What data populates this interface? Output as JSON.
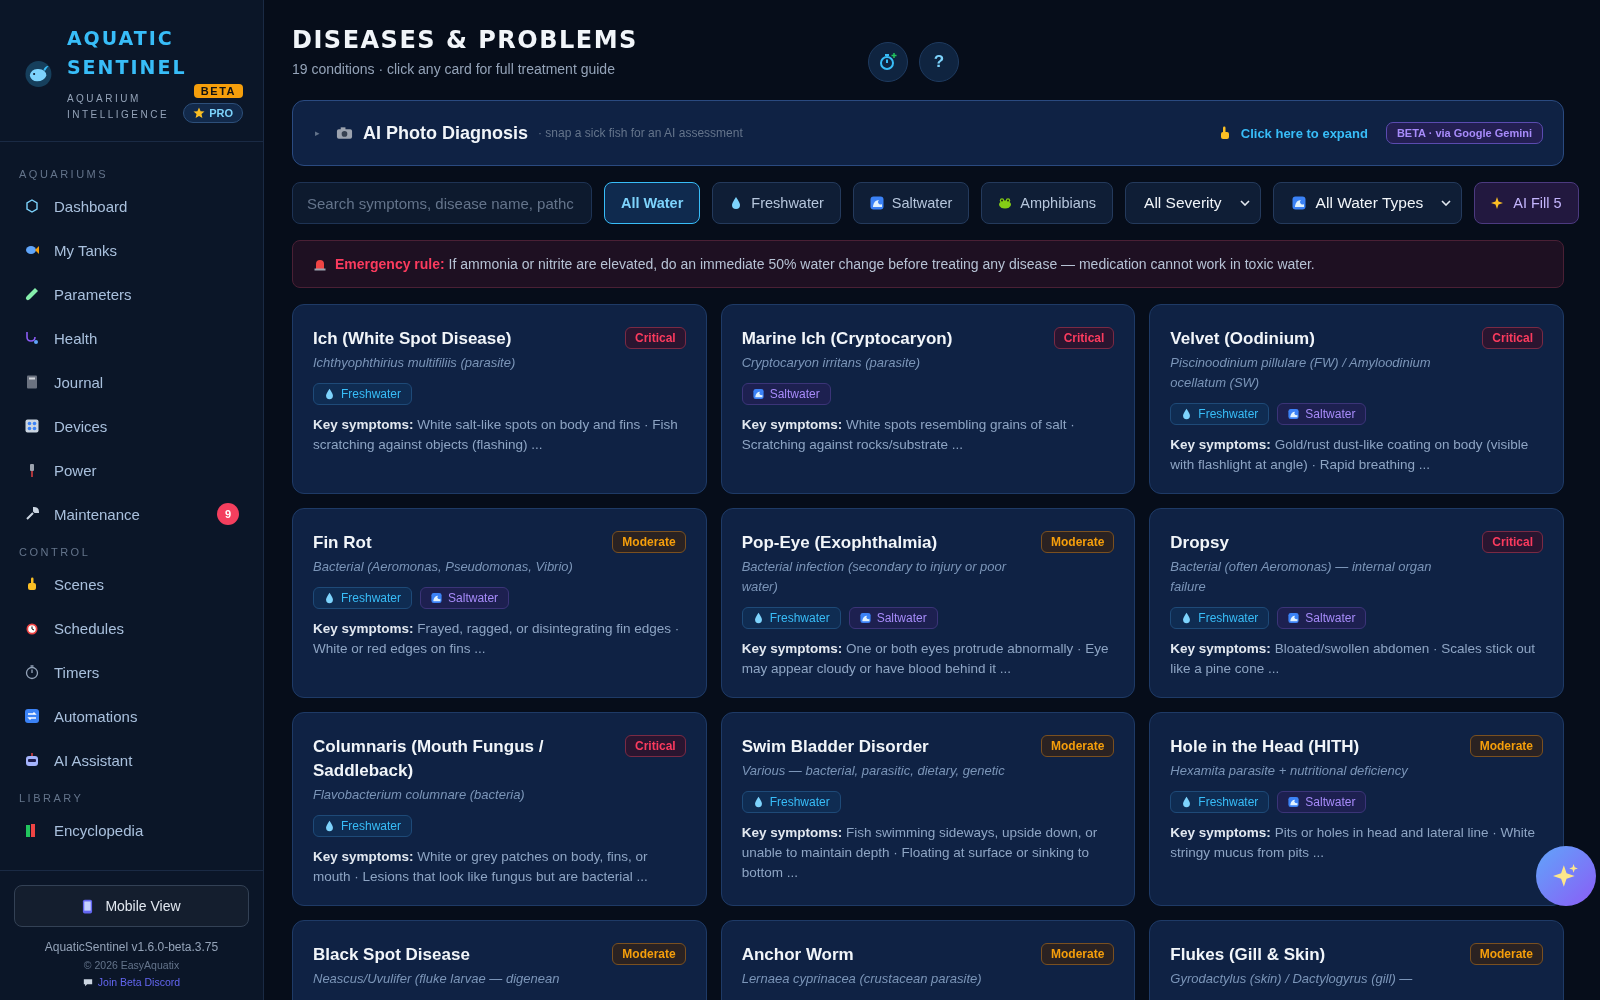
{
  "brand": {
    "name_line1": "AQUATIC",
    "name_line2": "SENTINEL",
    "tagline_line1": "AQUARIUM",
    "tagline_line2": "INTELLIGENCE",
    "beta": "BETA",
    "pro": "PRO"
  },
  "sidebar": {
    "sections": [
      {
        "title": "AQUARIUMS",
        "items": [
          {
            "label": "Dashboard"
          },
          {
            "label": "My Tanks"
          },
          {
            "label": "Parameters"
          },
          {
            "label": "Health"
          },
          {
            "label": "Journal"
          },
          {
            "label": "Devices"
          },
          {
            "label": "Power"
          },
          {
            "label": "Maintenance",
            "badge": "9"
          }
        ]
      },
      {
        "title": "CONTROL",
        "items": [
          {
            "label": "Scenes"
          },
          {
            "label": "Schedules"
          },
          {
            "label": "Timers"
          },
          {
            "label": "Automations"
          },
          {
            "label": "AI Assistant"
          }
        ]
      },
      {
        "title": "LIBRARY",
        "items": [
          {
            "label": "Encyclopedia"
          }
        ]
      }
    ],
    "mobile_button": "Mobile View",
    "version": "AquaticSentinel v1.6.0-beta.3.75",
    "copyright": "© 2026 EasyAquatix",
    "discord_link": "Join Beta Discord"
  },
  "header": {
    "title": "DISEASES & PROBLEMS",
    "subtitle": "19 conditions · click any card for full treatment guide",
    "help_button": "?"
  },
  "photo_diagnosis": {
    "caret": "▸",
    "title": "AI Photo Diagnosis",
    "hint": "· snap a sick fish for an AI assessment",
    "expand_link": "Click here to expand",
    "badge": "BETA · via Google Gemini"
  },
  "filters": {
    "search": {
      "placeholder": "Search symptoms, disease name, pathc"
    },
    "water_buttons": [
      {
        "label": "All Water",
        "kind": "all",
        "selected": true
      },
      {
        "label": "Freshwater",
        "kind": "freshwater",
        "selected": false
      },
      {
        "label": "Saltwater",
        "kind": "saltwater",
        "selected": false
      },
      {
        "label": "Amphibians",
        "kind": "amphibians",
        "selected": false
      }
    ],
    "severity_select": "All Severity",
    "water_type_select": "All Water Types",
    "ai_fill_button": "AI Fill 5"
  },
  "emergency": "**Emergency rule:** If ammonia or nitrite are elevated, do an immediate 50% water change before treating any disease — medication cannot work in toxic water.",
  "cards": [
    {
      "title": "Ich (White Spot Disease)",
      "severity": "Critical",
      "kind": "critical",
      "cause": "Ichthyophthirius multifiliis (parasite)",
      "tags": [
        {
          "label": "Freshwater",
          "kind": "freshwater"
        }
      ],
      "symptoms": "**Key symptoms:** White salt-like spots on body and fins · Fish scratching against objects (flashing) ..."
    },
    {
      "title": "Marine Ich (Cryptocaryon)",
      "severity": "Critical",
      "kind": "critical",
      "cause": "Cryptocaryon irritans (parasite)",
      "tags": [
        {
          "label": "Saltwater",
          "kind": "saltwater"
        }
      ],
      "symptoms": "**Key symptoms:** White spots resembling grains of salt · Scratching against rocks/substrate ..."
    },
    {
      "title": "Velvet (Oodinium)",
      "severity": "Critical",
      "kind": "critical",
      "cause": "Piscinoodinium pillulare (FW) / Amyloodinium ocellatum (SW)",
      "tags": [
        {
          "label": "Freshwater",
          "kind": "freshwater"
        },
        {
          "label": "Saltwater",
          "kind": "saltwater"
        }
      ],
      "symptoms": "**Key symptoms:** Gold/rust dust-like coating on body (visible with flashlight at angle) · Rapid breathing ..."
    },
    {
      "title": "Fin Rot",
      "severity": "Moderate",
      "kind": "moderate",
      "cause": "Bacterial (Aeromonas, Pseudomonas, Vibrio)",
      "tags": [
        {
          "label": "Freshwater",
          "kind": "freshwater"
        },
        {
          "label": "Saltwater",
          "kind": "saltwater"
        }
      ],
      "symptoms": "**Key symptoms:** Frayed, ragged, or disintegrating fin edges · White or red edges on fins ..."
    },
    {
      "title": "Pop-Eye (Exophthalmia)",
      "severity": "Moderate",
      "kind": "moderate",
      "cause": "Bacterial infection (secondary to injury or poor water)",
      "tags": [
        {
          "label": "Freshwater",
          "kind": "freshwater"
        },
        {
          "label": "Saltwater",
          "kind": "saltwater"
        }
      ],
      "symptoms": "**Key symptoms:** One or both eyes protrude abnormally · Eye may appear cloudy or have blood behind it ..."
    },
    {
      "title": "Dropsy",
      "severity": "Critical",
      "kind": "critical",
      "cause": "Bacterial (often Aeromonas) — internal organ failure",
      "tags": [
        {
          "label": "Freshwater",
          "kind": "freshwater"
        },
        {
          "label": "Saltwater",
          "kind": "saltwater"
        }
      ],
      "symptoms": "**Key symptoms:** Bloated/swollen abdomen · Scales stick out like a pine cone ..."
    },
    {
      "title": "Columnaris (Mouth Fungus / Saddleback)",
      "severity": "Critical",
      "kind": "critical",
      "cause": "Flavobacterium columnare (bacteria)",
      "tags": [
        {
          "label": "Freshwater",
          "kind": "freshwater"
        }
      ],
      "symptoms": "**Key symptoms:** White or grey patches on body, fins, or mouth · Lesions that look like fungus but are bacterial ..."
    },
    {
      "title": "Swim Bladder Disorder",
      "severity": "Moderate",
      "kind": "moderate",
      "cause": "Various — bacterial, parasitic, dietary, genetic",
      "tags": [
        {
          "label": "Freshwater",
          "kind": "freshwater"
        }
      ],
      "symptoms": "**Key symptoms:** Fish swimming sideways, upside down, or unable to maintain depth · Floating at surface or sinking to bottom ..."
    },
    {
      "title": "Hole in the Head (HITH)",
      "severity": "Moderate",
      "kind": "moderate",
      "cause": "Hexamita parasite + nutritional deficiency",
      "tags": [
        {
          "label": "Freshwater",
          "kind": "freshwater"
        },
        {
          "label": "Saltwater",
          "kind": "saltwater"
        }
      ],
      "symptoms": "**Key symptoms:** Pits or holes in head and lateral line · White stringy mucus from pits ..."
    },
    {
      "title": "Black Spot Disease",
      "severity": "Moderate",
      "kind": "moderate",
      "cause": "Neascus/Uvulifer (fluke larvae — digenean"
    },
    {
      "title": "Anchor Worm",
      "severity": "Moderate",
      "kind": "moderate",
      "cause": "Lernaea cyprinacea (crustacean parasite)"
    },
    {
      "title": "Flukes (Gill & Skin)",
      "severity": "Moderate",
      "kind": "moderate",
      "cause": "Gyrodactylus (skin) / Dactylogyrus (gill) —"
    }
  ]
}
